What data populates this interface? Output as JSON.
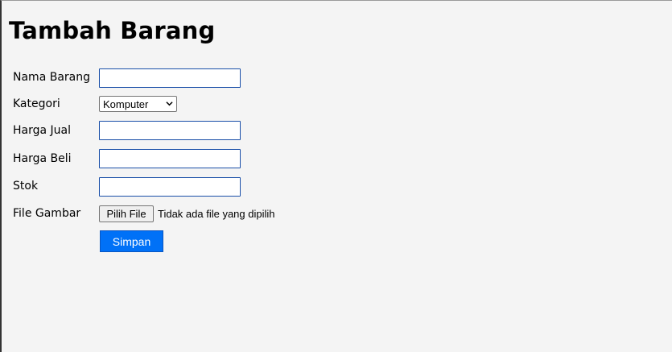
{
  "page": {
    "title": "Tambah Barang"
  },
  "form": {
    "fields": [
      {
        "label": "Nama Barang",
        "value": ""
      },
      {
        "label": "Kategori",
        "selected": "Komputer"
      },
      {
        "label": "Harga Jual",
        "value": ""
      },
      {
        "label": "Harga Beli",
        "value": ""
      },
      {
        "label": "Stok",
        "value": ""
      },
      {
        "label": "File Gambar"
      }
    ],
    "file_button_label": "Pilih File",
    "file_status": "Tidak ada file yang dipilih",
    "submit_label": "Simpan"
  },
  "colors": {
    "background": "#f4f4f4",
    "input_border": "#1a4fa8",
    "submit_bg": "#0071f7",
    "submit_text": "#ffffff"
  },
  "icons": {
    "select_chevron": "chevron-down-icon"
  }
}
